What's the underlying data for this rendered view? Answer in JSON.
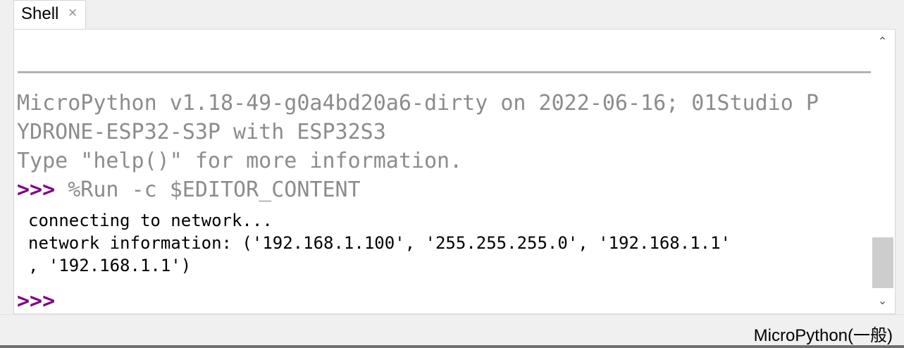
{
  "tab": {
    "label": "Shell",
    "close_glyph": "×"
  },
  "shell": {
    "banner_line1": "MicroPython v1.18-49-g0a4bd20a6-dirty on 2022-06-16; 01Studio P",
    "banner_line2": "YDRONE-ESP32-S3P with ESP32S3",
    "banner_line3": "Type \"help()\" for more information.",
    "prompt": ">>>",
    "command": " %Run -c $EDITOR_CONTENT",
    "output_line1": "connecting to network...",
    "output_line2": "network information: ('192.168.1.100', '255.255.255.0', '192.168.1.1'",
    "output_line3": ", '192.168.1.1')",
    "final_prompt": ">>>"
  },
  "scrollbar": {
    "up_icon": "chevron-up-icon",
    "down_icon": "chevron-down-icon",
    "up_glyph": "⌃",
    "down_glyph": "⌄"
  },
  "status": {
    "interpreter": "MicroPython(一般)"
  },
  "colors": {
    "prompt": "#800080",
    "banner": "#8c8c8c",
    "output": "#000000"
  }
}
